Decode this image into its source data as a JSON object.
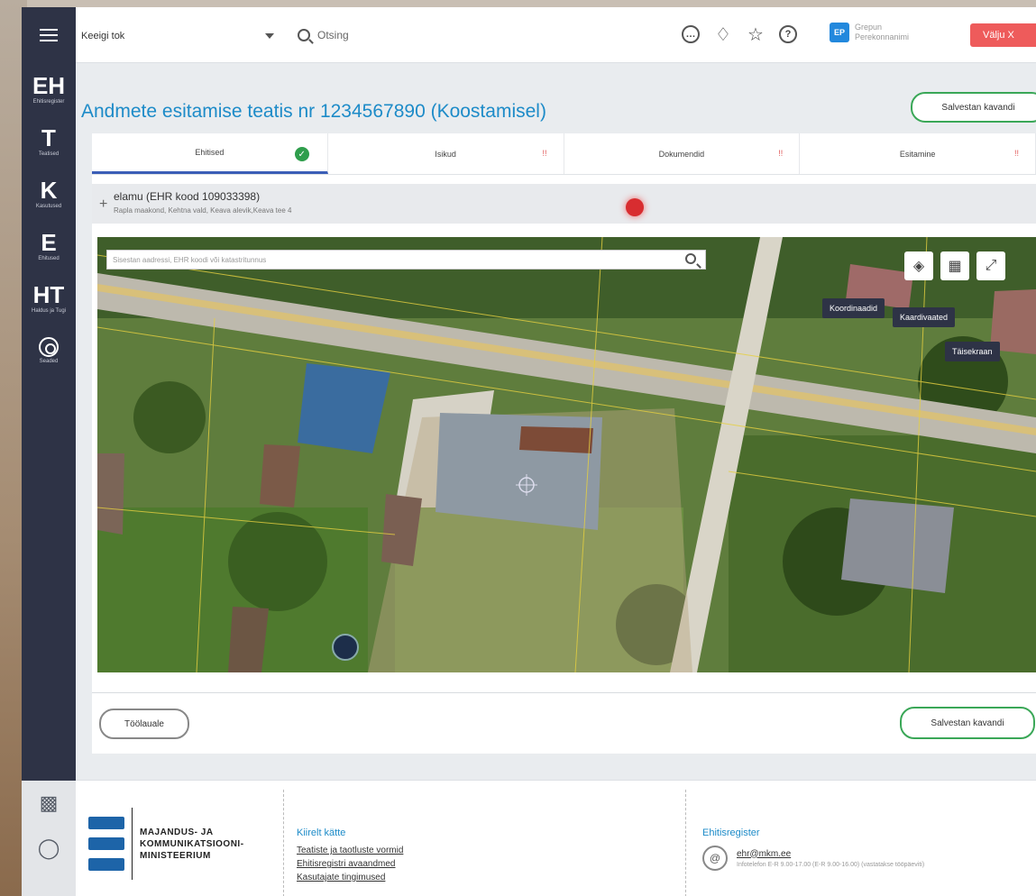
{
  "topbar": {
    "language_value": "Keeigi tok",
    "search_placeholder": "Otsing",
    "user_line1": "Grepun",
    "user_line2": "Perekonnanimi",
    "logout_label": "Välju X"
  },
  "sidebar": {
    "items": [
      {
        "abbr": "EH",
        "label": "Ehitisregister"
      },
      {
        "abbr": "T",
        "label": "Teatised"
      },
      {
        "abbr": "K",
        "label": "Kasutused"
      },
      {
        "abbr": "E",
        "label": "Ehitused"
      },
      {
        "abbr": "HT",
        "label": "Haldus ja Tugi"
      },
      {
        "abbr": "",
        "label": "Seaded"
      }
    ]
  },
  "page": {
    "title": "Andmete esitamise teatis nr 1234567890 (Koostamisel)",
    "save_label": "Salvestan kavandi",
    "tabs": [
      {
        "label": "Ehitised",
        "state": "ok"
      },
      {
        "label": "Isikud",
        "state": "warn"
      },
      {
        "label": "Dokumendid",
        "state": "warn"
      },
      {
        "label": "Esitamine",
        "state": "warn"
      }
    ],
    "object_title": "elamu (EHR kood 109033398)",
    "object_address": "Rapla maakond, Kehtna vald, Keava alevik,Keava tee 4",
    "map_search_placeholder": "Sisestan aadressi, EHR koodi või katastritunnus",
    "tooltips": {
      "coordinates": "Koordinaadid",
      "map_layers": "Kaardivaated",
      "fullscreen": "Täisekraan"
    },
    "back_label": "Töölauale",
    "save_bottom_label": "Salvestan kavandi"
  },
  "footer": {
    "ministry_line1": "MAJANDUS- JA",
    "ministry_line2": "KOMMUNIKATSIOONI-",
    "ministry_line3": "MINISTEERIUM",
    "quick_heading": "Kiirelt kätte",
    "quick_links": [
      "Teatiste ja taotluste vormid",
      "Ehitisregistri avaandmed",
      "Kasutajate tingimused"
    ],
    "register_heading": "Ehitisregister",
    "email": "ehr@mkm.ee",
    "email_sub": "Infotelefon E-R 9.00-17.00 (E-R 9.00-16.00) (vastatakse tööpäeviti)"
  },
  "colors": {
    "sidebar": "#2e3346",
    "accent": "#1d8bc8",
    "green": "#3aa757",
    "logout": "#ee5b5b"
  }
}
